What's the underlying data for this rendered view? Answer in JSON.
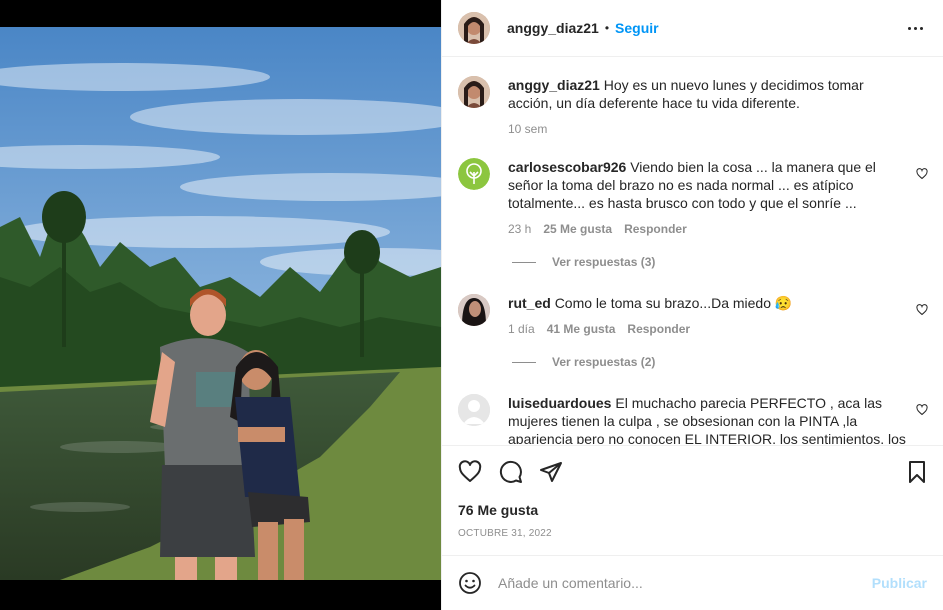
{
  "post": {
    "username": "anggy_diaz21",
    "separator": "•",
    "follow_label": "Seguir"
  },
  "comments": [
    {
      "username": "anggy_diaz21",
      "text": "Hoy es un nuevo lunes y decidimos tomar acción, un día deferente hace tu vida diferente.",
      "time": "10 sem"
    },
    {
      "username": "carlosescobar926",
      "text": "Viendo bien la cosa ... la manera que el señor la toma del brazo no es nada normal ... es atípico totalmente... es hasta brusco con todo y que el sonríe ...",
      "time": "23 h",
      "likes": "25 Me gusta",
      "reply": "Responder",
      "view_replies": "Ver respuestas (3)"
    },
    {
      "username": "rut_ed",
      "text": "Como le toma su brazo...Da miedo 😥",
      "time": "1 día",
      "likes": "41 Me gusta",
      "reply": "Responder",
      "view_replies": "Ver respuestas (2)"
    },
    {
      "username": "luiseduardoues",
      "text": "El muchacho parecia PERFECTO , aca las mujeres tienen la culpa , se obsesionan con la PINTA ,la apariencia pero no conocen EL INTERIOR, los sentimientos, los"
    }
  ],
  "footer": {
    "likes": "76 Me gusta",
    "date": "OCTUBRE 31, 2022",
    "comment_placeholder": "Añade un comentario...",
    "publish_label": "Publicar"
  },
  "icons": {
    "more": "more-options-icon",
    "heart": "heart-icon",
    "comment": "comment-icon",
    "share": "share-icon",
    "save": "bookmark-icon",
    "emoji": "emoji-icon"
  }
}
